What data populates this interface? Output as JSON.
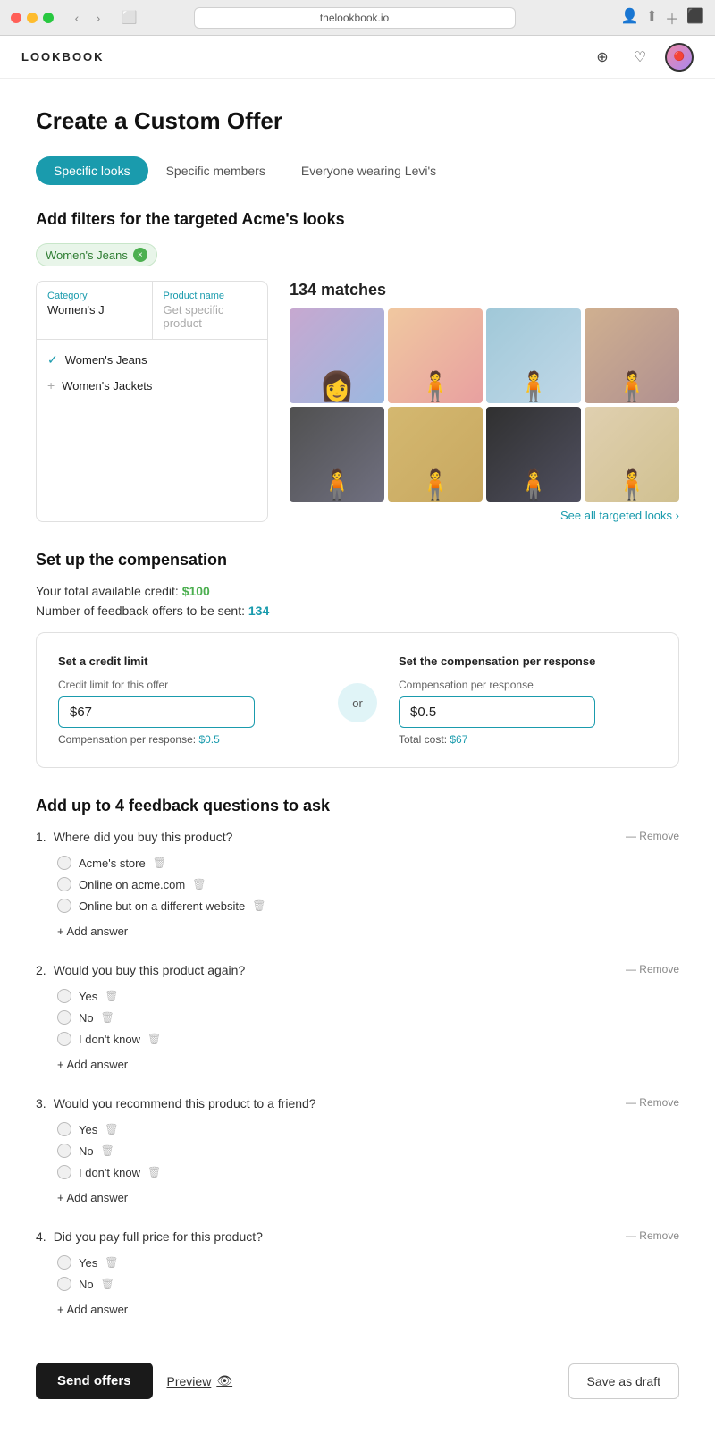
{
  "browser": {
    "url": "thelookbook.io",
    "tab_icon": "🌐"
  },
  "app": {
    "logo": "LOOKBOOK"
  },
  "page": {
    "title": "Create a Custom Offer"
  },
  "tabs": [
    {
      "id": "specific-looks",
      "label": "Specific looks",
      "active": true
    },
    {
      "id": "specific-members",
      "label": "Specific members",
      "active": false
    },
    {
      "id": "everyone-levis",
      "label": "Everyone wearing Levi's",
      "active": false
    }
  ],
  "filters_section": {
    "title": "Add filters for the targeted Acme's looks",
    "active_filter": "Women's Jeans",
    "filter_close": "×",
    "category_label": "Category",
    "category_value": "Women's J",
    "product_name_label": "Product name",
    "product_name_placeholder": "Get specific product",
    "options": [
      {
        "label": "Women's Jeans",
        "selected": true
      },
      {
        "label": "Women's Jackets",
        "selected": false
      }
    ]
  },
  "matches": {
    "count": "134 matches",
    "see_all": "See all targeted looks",
    "images": [
      {
        "id": 1,
        "class": "img1"
      },
      {
        "id": 2,
        "class": "img2"
      },
      {
        "id": 3,
        "class": "img3"
      },
      {
        "id": 4,
        "class": "img4"
      },
      {
        "id": 5,
        "class": "img5"
      },
      {
        "id": 6,
        "class": "img6"
      },
      {
        "id": 7,
        "class": "img7"
      },
      {
        "id": 8,
        "class": "img8"
      }
    ]
  },
  "compensation": {
    "section_title": "Set up the compensation",
    "credit_label": "Your total available credit:",
    "credit_value": "$100",
    "feedback_label": "Number of feedback offers to be sent:",
    "feedback_count": "134",
    "left_panel_title": "Set a credit limit",
    "credit_limit_label": "Credit limit for this offer",
    "credit_limit_value": "$67",
    "compensation_sub_label": "Compensation per response:",
    "compensation_sub_value": "$0.5",
    "or_text": "or",
    "right_panel_title": "Set the compensation per response",
    "comp_per_response_label": "Compensation per response",
    "comp_per_response_value": "$0.5",
    "total_cost_label": "Total cost:",
    "total_cost_value": "$67"
  },
  "questions": {
    "section_title": "Add up to 4 feedback questions to ask",
    "items": [
      {
        "number": "1.",
        "text": "Where did you buy this product?",
        "remove_label": "— Remove",
        "answers": [
          {
            "text": "Acme's store"
          },
          {
            "text": "Online on acme.com"
          },
          {
            "text": "Online but on a different website"
          }
        ],
        "add_answer": "+ Add answer"
      },
      {
        "number": "2.",
        "text": "Would you buy this product again?",
        "remove_label": "— Remove",
        "answers": [
          {
            "text": "Yes"
          },
          {
            "text": "No"
          },
          {
            "text": "I don't know"
          }
        ],
        "add_answer": "+ Add answer"
      },
      {
        "number": "3.",
        "text": "Would you recommend this product to a friend?",
        "remove_label": "— Remove",
        "answers": [
          {
            "text": "Yes"
          },
          {
            "text": "No"
          },
          {
            "text": "I don't know"
          }
        ],
        "add_answer": "+ Add answer"
      },
      {
        "number": "4.",
        "text": "Did you pay full price for this product?",
        "remove_label": "— Remove",
        "answers": [
          {
            "text": "Yes"
          },
          {
            "text": "No"
          }
        ],
        "add_answer": "+ Add answer"
      }
    ]
  },
  "footer": {
    "send_label": "Send offers",
    "preview_label": "Preview",
    "preview_icon": "👁",
    "draft_label": "Save as draft"
  }
}
